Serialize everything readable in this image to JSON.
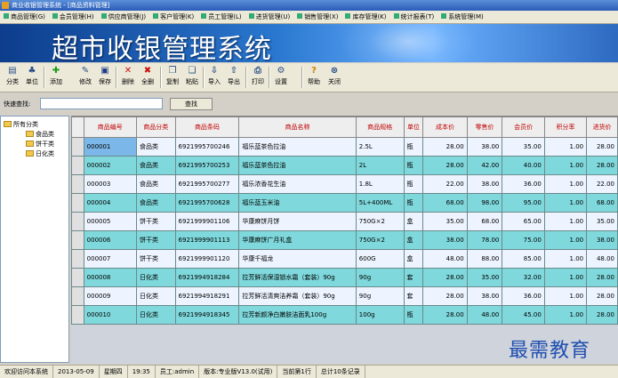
{
  "window": {
    "title": "商业收银管理系统 - [商品资料管理]"
  },
  "menu": [
    "商品管理(G)",
    "会员管理(H)",
    "供应商管理(J)",
    "客户管理(K)",
    "员工管理(L)",
    "进货管理(U)",
    "销售管理(X)",
    "库存管理(K)",
    "统计报表(T)",
    "系统管理(M)"
  ],
  "banner": {
    "title": "超市收银管理系统"
  },
  "toolbar": [
    {
      "label": "分类",
      "icon": "category-icon"
    },
    {
      "label": "单位",
      "icon": "unit-icon"
    },
    {
      "label": "添加",
      "icon": "add-icon"
    },
    {
      "label": "修改",
      "icon": "edit-icon"
    },
    {
      "label": "保存",
      "icon": "save-icon"
    },
    {
      "label": "删除",
      "icon": "delete-icon"
    },
    {
      "label": "全删",
      "icon": "delete-all-icon"
    },
    {
      "label": "复制",
      "icon": "copy-icon"
    },
    {
      "label": "粘贴",
      "icon": "paste-icon"
    },
    {
      "label": "导入",
      "icon": "import-icon"
    },
    {
      "label": "导出",
      "icon": "export-icon"
    },
    {
      "label": "打印",
      "icon": "print-icon"
    },
    {
      "label": "设置",
      "icon": "settings-icon"
    },
    {
      "label": "帮助",
      "icon": "help-icon"
    },
    {
      "label": "关闭",
      "icon": "close-icon"
    }
  ],
  "search": {
    "label": "快速查找:",
    "value": "",
    "button": "查找"
  },
  "tree": {
    "root": "所有分类",
    "children": [
      "食品类",
      "饼干类",
      "日化类"
    ]
  },
  "table": {
    "columns": [
      "商品编号",
      "商品分类",
      "商品条码",
      "商品名称",
      "商品规格",
      "单位",
      "成本价",
      "零售价",
      "会员价",
      "积分率",
      "进货价"
    ],
    "rows": [
      [
        "000001",
        "食品类",
        "6921995700246",
        "福乐蓝茶色拉油",
        "2.5L",
        "瓶",
        "28.00",
        "38.00",
        "35.00",
        "1.00",
        "28.00"
      ],
      [
        "000002",
        "食品类",
        "6921995700253",
        "福乐蓝茶色拉油",
        "2L",
        "瓶",
        "28.00",
        "42.00",
        "40.00",
        "1.00",
        "28.00"
      ],
      [
        "000003",
        "食品类",
        "6921995700277",
        "福乐浓香花生油",
        "1.8L",
        "瓶",
        "22.00",
        "38.00",
        "36.00",
        "1.00",
        "22.00"
      ],
      [
        "000004",
        "食品类",
        "6921995700628",
        "福乐蓝玉米油",
        "5L+400ML",
        "瓶",
        "68.00",
        "98.00",
        "95.00",
        "1.00",
        "68.00"
      ],
      [
        "000005",
        "饼干类",
        "6921999901106",
        "华康麻饼月饼",
        "750G×2",
        "盒",
        "35.00",
        "68.00",
        "65.00",
        "1.00",
        "35.00"
      ],
      [
        "000006",
        "饼干类",
        "6921999901113",
        "华康麻饼广月礼盒",
        "750G×2",
        "盒",
        "38.00",
        "78.00",
        "75.00",
        "1.00",
        "38.00"
      ],
      [
        "000007",
        "饼干类",
        "6921999901120",
        "华康千福龙",
        "600G",
        "盒",
        "48.00",
        "88.00",
        "85.00",
        "1.00",
        "48.00"
      ],
      [
        "000008",
        "日化类",
        "6921994918284",
        "拉芳鲜活保湿锁水霜（套装）90g",
        "90g",
        "套",
        "28.00",
        "35.00",
        "32.00",
        "1.00",
        "28.00"
      ],
      [
        "000009",
        "日化类",
        "6921994918291",
        "拉芳鲜活清爽洁养霜（套装）90g",
        "90g",
        "套",
        "28.00",
        "38.00",
        "36.00",
        "1.00",
        "28.00"
      ],
      [
        "000010",
        "日化类",
        "6921994918345",
        "拉芳新颜净白嫩肤洁面乳100g",
        "100g",
        "瓶",
        "28.00",
        "48.00",
        "45.00",
        "1.00",
        "28.00"
      ]
    ]
  },
  "status": [
    "欢迎访问本系统",
    "2013-05-09",
    "星期四",
    "19:35",
    "员工:admin",
    "版本:专业版V13.0(试用)",
    "当前第1行",
    "总计10条记录"
  ],
  "watermark": "最需教育",
  "colors": {
    "row_even": "#7fd8dc",
    "row_odd": "#eef4ff",
    "header_text": "#c00000",
    "banner": "#2a78d0"
  }
}
